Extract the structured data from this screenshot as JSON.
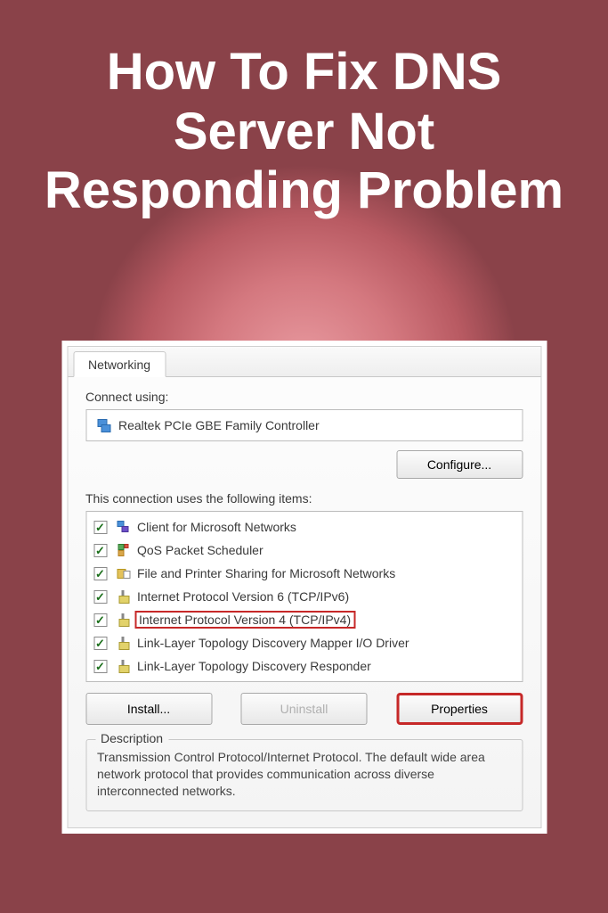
{
  "headline": "How To Fix DNS Server Not Responding Problem",
  "dialog": {
    "tab_label": "Networking",
    "connect_label": "Connect using:",
    "adapter_name": "Realtek PCIe GBE Family Controller",
    "configure_label": "Configure...",
    "items_label": "This connection uses the following items:",
    "items": [
      {
        "label": "Client for Microsoft Networks",
        "icon": "client",
        "highlight": false
      },
      {
        "label": "QoS Packet Scheduler",
        "icon": "qos",
        "highlight": false
      },
      {
        "label": "File and Printer Sharing for Microsoft Networks",
        "icon": "fileshare",
        "highlight": false
      },
      {
        "label": "Internet Protocol Version 6 (TCP/IPv6)",
        "icon": "proto",
        "highlight": false
      },
      {
        "label": "Internet Protocol Version 4 (TCP/IPv4)",
        "icon": "proto",
        "highlight": true
      },
      {
        "label": "Link-Layer Topology Discovery Mapper I/O Driver",
        "icon": "proto",
        "highlight": false
      },
      {
        "label": "Link-Layer Topology Discovery Responder",
        "icon": "proto",
        "highlight": false
      }
    ],
    "install_label": "Install...",
    "uninstall_label": "Uninstall",
    "properties_label": "Properties",
    "description_title": "Description",
    "description_text": "Transmission Control Protocol/Internet Protocol. The default wide area network protocol that provides communication across diverse interconnected networks."
  }
}
